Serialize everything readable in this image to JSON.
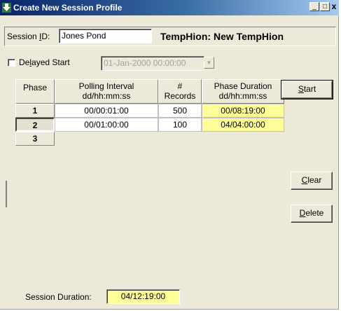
{
  "window": {
    "title": "Create New Session Profile",
    "buttons": {
      "minimize": "_",
      "maximize": "□",
      "close": "x"
    }
  },
  "session": {
    "id_label_pre": "Session ",
    "id_label_key": "I",
    "id_label_post": "D:",
    "id_value": "Jones Pond",
    "device_label": "TempHion: New TempHion"
  },
  "delayed_start": {
    "label_pre": "De",
    "label_key": "l",
    "label_post": "ayed Start",
    "checked": false,
    "datetime": "01-Jan-2000 00:00:00"
  },
  "grid": {
    "headers": {
      "phase": "Phase",
      "polling_line1": "Polling Interval",
      "polling_line2": "dd/hh:mm:ss",
      "records_line1": "#",
      "records_line2": "Records",
      "duration_line1": "Phase Duration",
      "duration_line2": "dd/hh:mm:ss"
    },
    "rows": [
      {
        "phase": "1",
        "polling": "00/00:01:00",
        "records": "500",
        "duration": "00/08:19:00"
      },
      {
        "phase": "2",
        "polling": "00/01:00:00",
        "records": "100",
        "duration": "04/04:00:00"
      },
      {
        "phase": "3",
        "polling": "",
        "records": "",
        "duration": ""
      }
    ]
  },
  "buttons": {
    "start_key": "S",
    "start_rest": "tart",
    "clear_key": "C",
    "clear_rest": "lear",
    "delete_key": "D",
    "delete_rest": "elete"
  },
  "footer": {
    "session_duration_label": "Session Duration:",
    "session_duration_value": "04/12:19:00"
  },
  "colors": {
    "title_gradient_start": "#0a246a",
    "title_gradient_end": "#a6caf0",
    "window_face": "#ece9d8",
    "duration_highlight": "#ffff99"
  }
}
